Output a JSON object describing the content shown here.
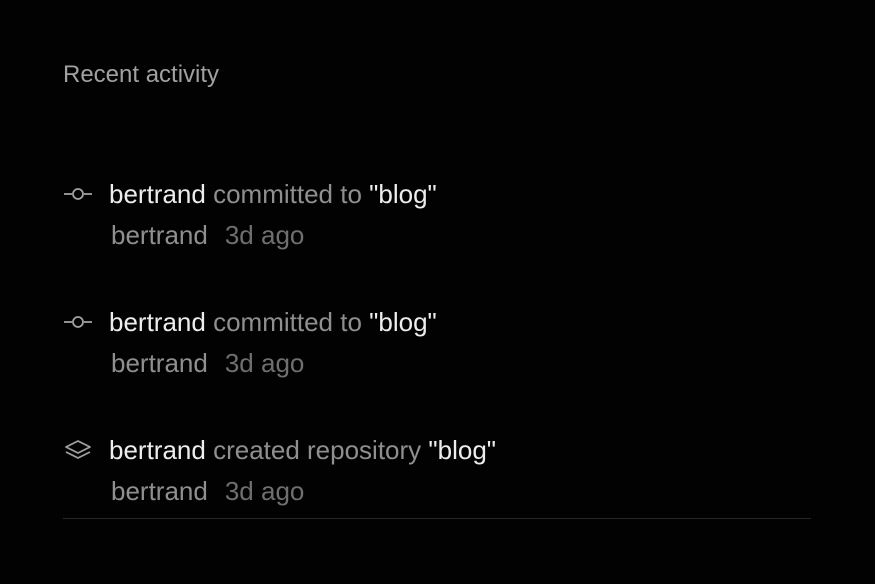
{
  "section": {
    "title": "Recent activity"
  },
  "activities": [
    {
      "icon": "git-commit-icon",
      "actor": "bertrand",
      "action": "committed to",
      "target": "\"blog\"",
      "meta_user": "bertrand",
      "meta_time": "3d ago"
    },
    {
      "icon": "git-commit-icon",
      "actor": "bertrand",
      "action": "committed to",
      "target": "\"blog\"",
      "meta_user": "bertrand",
      "meta_time": "3d ago"
    },
    {
      "icon": "layers-icon",
      "actor": "bertrand",
      "action": "created repository",
      "target": "\"blog\"",
      "meta_user": "bertrand",
      "meta_time": "3d ago"
    }
  ],
  "colors": {
    "background": "#020202",
    "primary_text": "#ededed",
    "secondary_text": "#8f8f8f",
    "muted_text": "#6f6f6f",
    "divider": "#262626"
  }
}
